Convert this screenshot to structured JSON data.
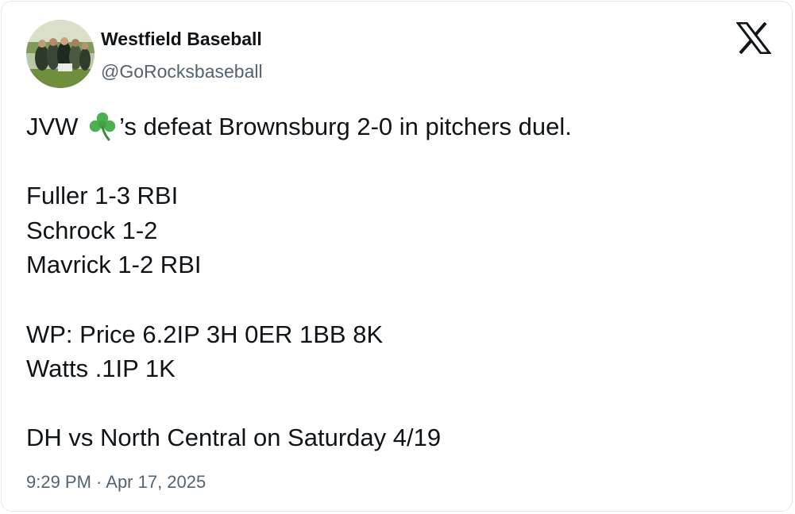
{
  "author": {
    "display_name": "Westfield Baseball",
    "handle": "@GoRocksbaseball",
    "avatar_icon": "team-photo-avatar"
  },
  "platform": {
    "logo_icon": "x-logo-icon"
  },
  "tweet": {
    "line1_before_emoji": "JVW ",
    "emoji_icon": "shamrock-icon",
    "emoji_char": "☘️",
    "line1_after_emoji": "’s defeat Brownsburg 2-0 in pitchers duel.",
    "stats": [
      "Fuller 1-3 RBI",
      "Schrock 1-2",
      "Mavrick 1-2 RBI"
    ],
    "pitching": [
      "WP: Price 6.2IP 3H 0ER 1BB 8K",
      "Watts .1IP 1K"
    ],
    "next_game": "DH vs North Central on Saturday 4/19"
  },
  "timestamp": "9:29 PM · Apr 17, 2025",
  "colors": {
    "text": "#0f1419",
    "secondary_text": "#536471",
    "border": "#e1e8ed",
    "shamrock": "#4caf50"
  }
}
